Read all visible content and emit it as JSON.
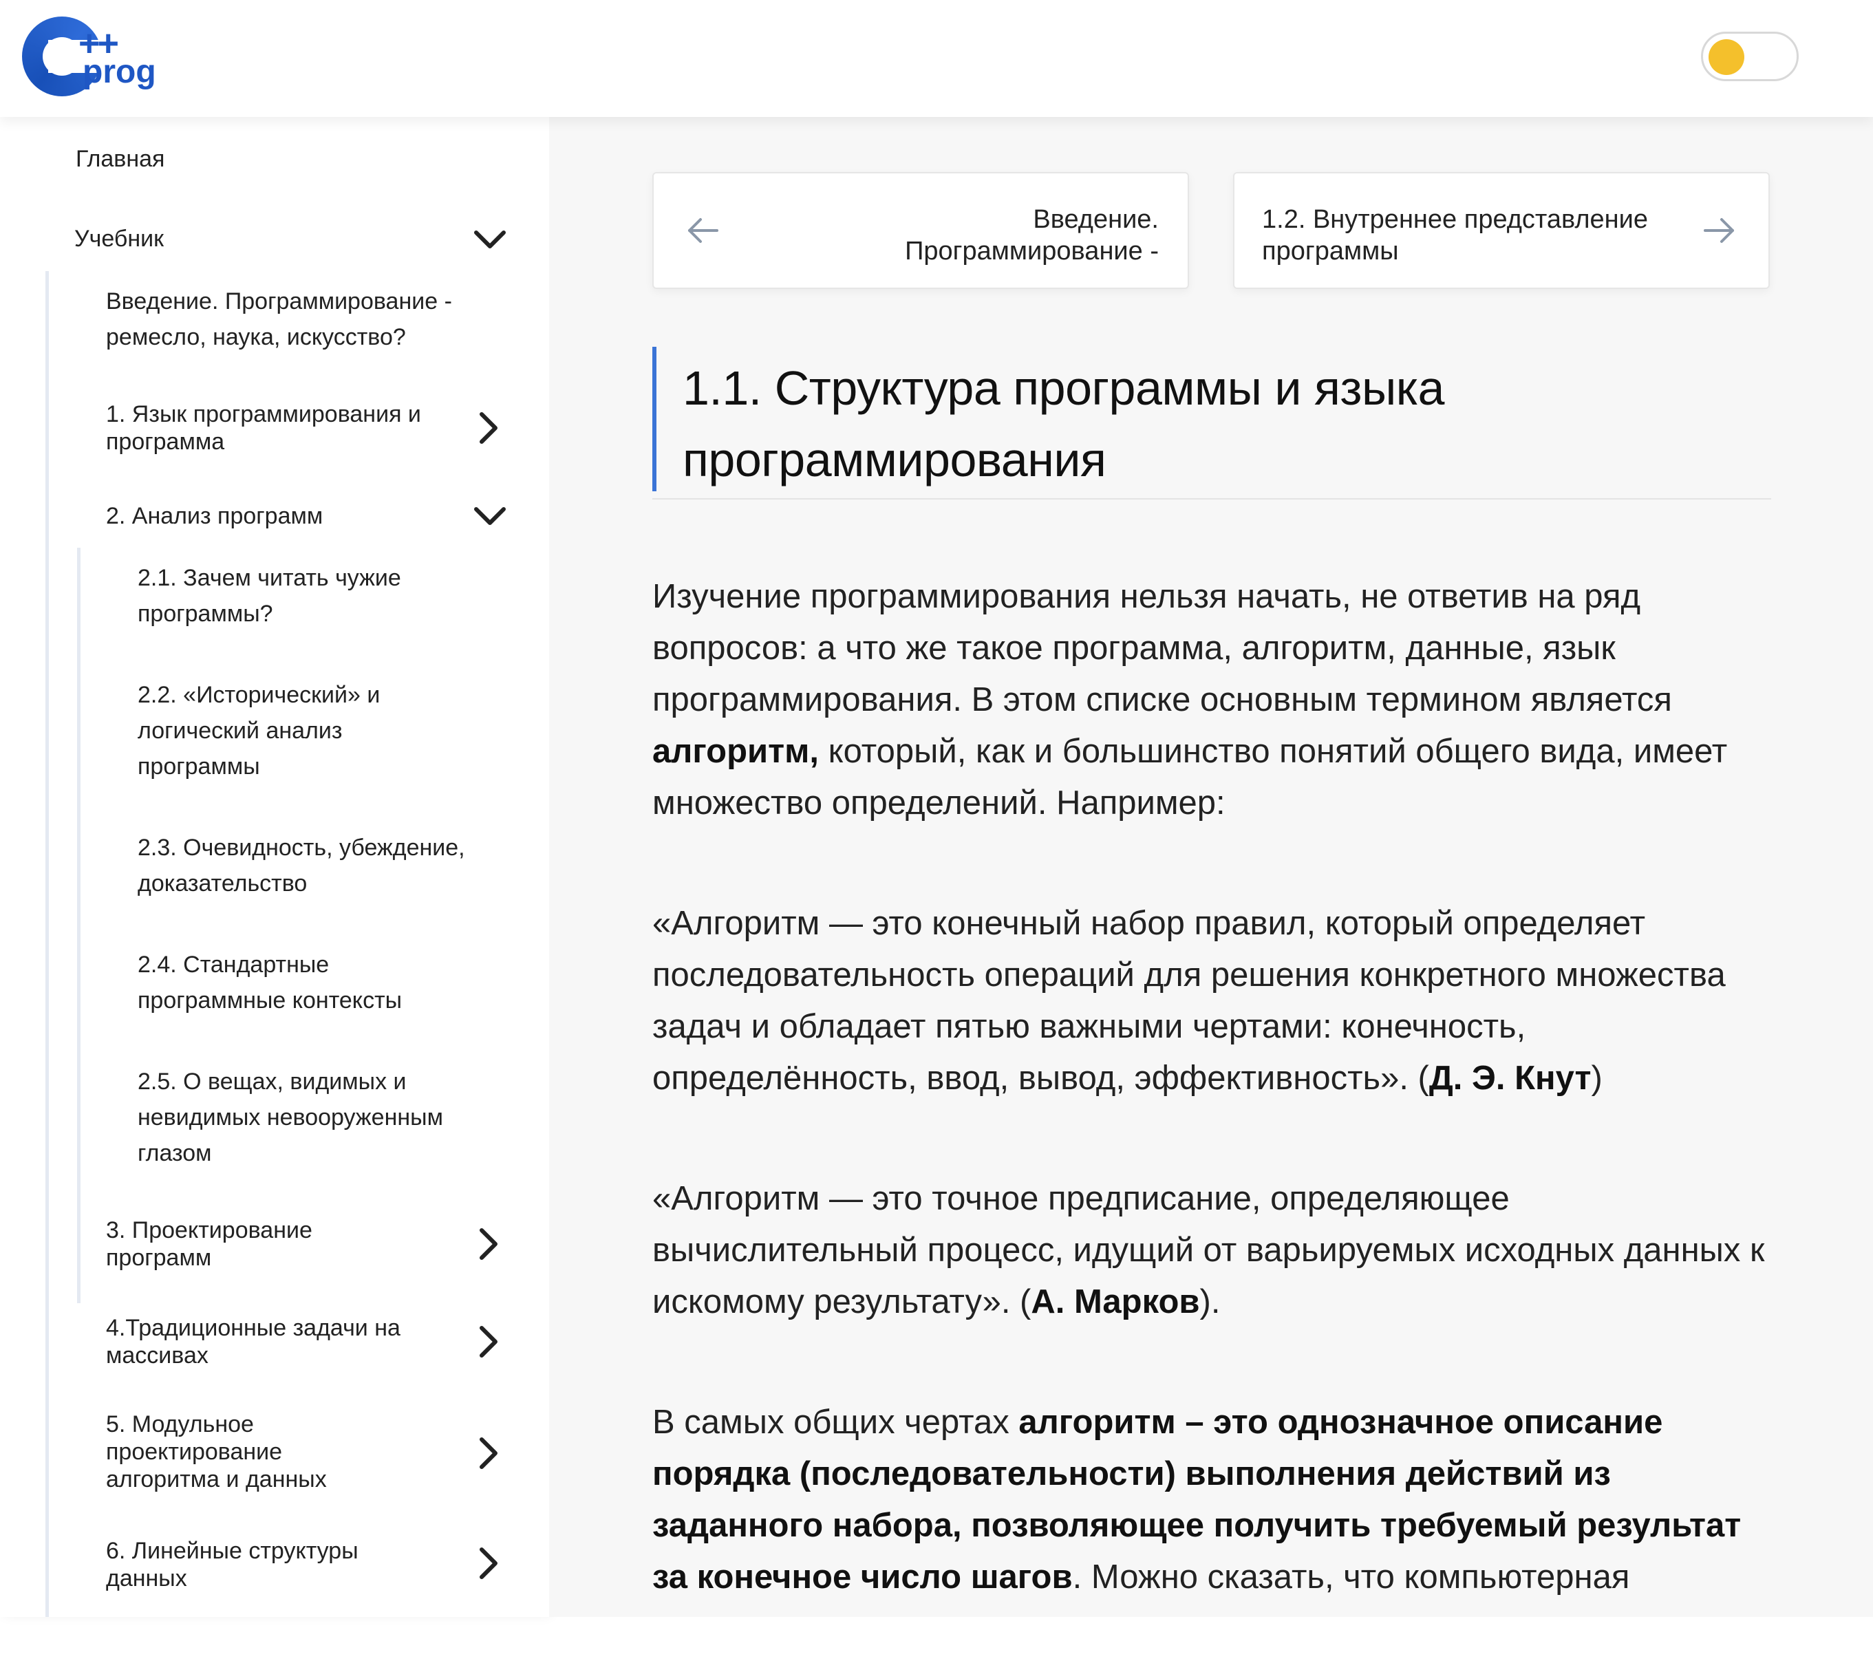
{
  "header": {
    "logo": {
      "plus_text": "++",
      "prog_text": "prog"
    },
    "theme_toggle_color": "#f4c02c"
  },
  "sidebar": {
    "home_label": "Главная",
    "book_label": "Учебник",
    "items": [
      {
        "label": "Введение. Программирование - ремесло, наука, искусство?"
      },
      {
        "label": "1. Язык программирования и программа"
      },
      {
        "label": "2. Анализ программ"
      },
      {
        "label": "3. Проектирование программ"
      },
      {
        "label": "4.Традиционные задачи на массивах"
      },
      {
        "label": "5. Модульное проектирование алгоритма и данных"
      },
      {
        "label": "6. Линейные структуры данных"
      }
    ],
    "subitems": [
      {
        "label": "2.1. Зачем читать чужие программы?"
      },
      {
        "label": "2.2. «Исторический» и логический анализ программы"
      },
      {
        "label": "2.3. Очевидность, убеждение, доказательство"
      },
      {
        "label": "2.4. Стандартные программные контексты"
      },
      {
        "label": "2.5. О вещах, видимых и невидимых невооруженным глазом"
      }
    ]
  },
  "pager": {
    "prev_label": "Введение. Программирование -",
    "next_label": "1.2. Внутреннее представление программы"
  },
  "article": {
    "title": "1.1. Структура программы и языка программирования",
    "p1_text": "Изучение программирования нельзя начать, не ответив на ряд вопросов: а что же такое программа, алгоритм, данные, язык программирования. В этом списке основным термином является ",
    "p1_bold": "алгоритм,",
    "p1_tail": " который, как и большинство понятий общего вида, имеет множество определений. Например:",
    "q1_text": "«Алгоритм — это конечный набор правил, который определяет последовательность операций для решения конкретного множества задач и обладает пятью важными чертами: конечность, определённость, ввод, вывод, эффективность». (",
    "q1_author": "Д. Э. Кнут",
    "q1_tail": ")",
    "q2_text": "«Алгоритм — это точное предписание, определяющее вычислительный процесс, идущий от варьируемых исходных данных к искомому результату». (",
    "q2_author": "А. Марков",
    "q2_tail": ").",
    "p4_text": "В самых общих чертах ",
    "p4_bold": "алгоритм – это однозначное описание порядка (последовательности) выполнения действий из заданного набора, позволяющее получить требуемый результат за конечное число шагов",
    "p4_tail": ". Можно сказать, что компьютерная"
  },
  "colors": {
    "accent": "#3b74d6",
    "logo_blue": "#1f57c4",
    "toggle_knob": "#f4c02c"
  }
}
